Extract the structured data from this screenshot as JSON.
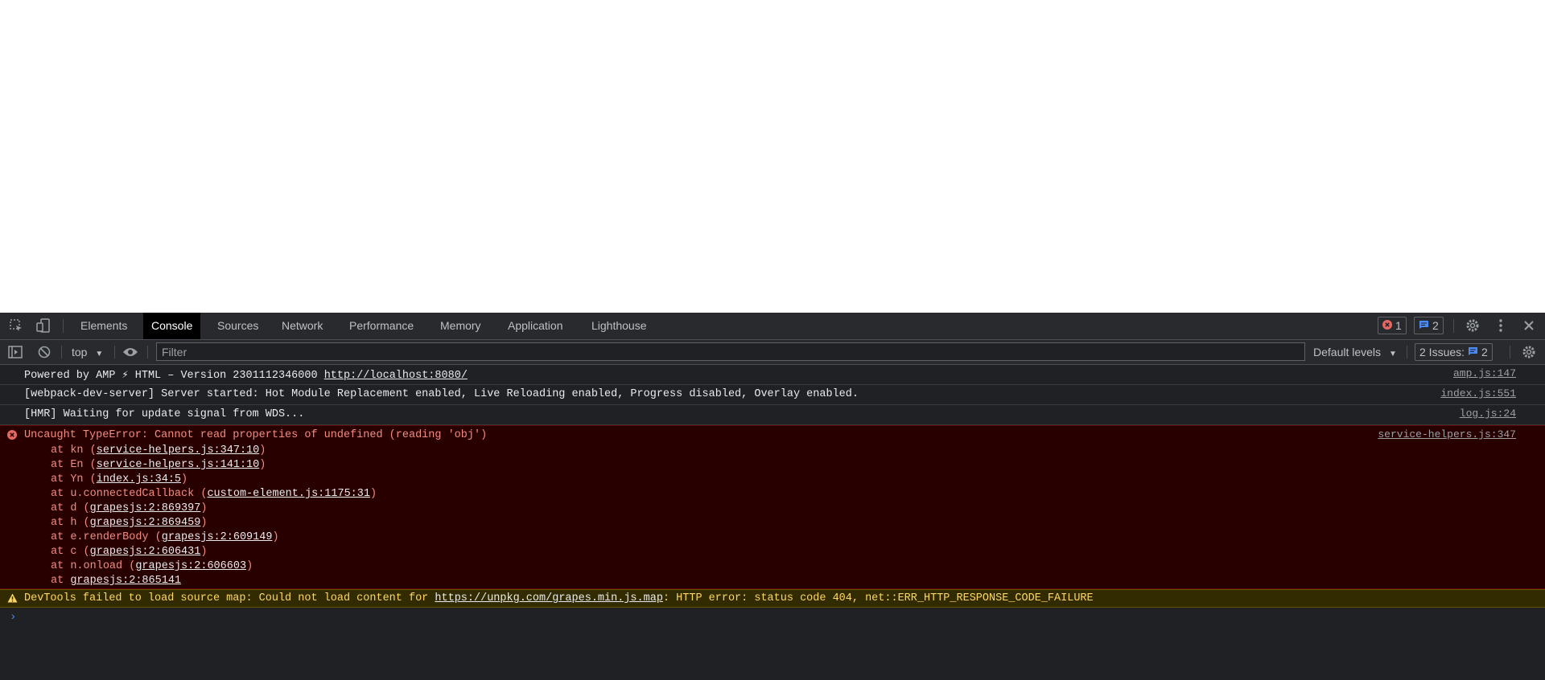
{
  "tabs": [
    {
      "label": "Elements",
      "active": false
    },
    {
      "label": "Console",
      "active": true
    },
    {
      "label": "Sources",
      "active": false
    },
    {
      "label": "Network",
      "active": false
    },
    {
      "label": "Performance",
      "active": false
    },
    {
      "label": "Memory",
      "active": false
    },
    {
      "label": "Application",
      "active": false
    },
    {
      "label": "Lighthouse",
      "active": false
    }
  ],
  "badges": {
    "errors": "1",
    "messages": "2"
  },
  "toolbar": {
    "context": "top",
    "filter_placeholder": "Filter",
    "levels": "Default levels",
    "issues_label": "2 Issues:",
    "issues_count": "2"
  },
  "messages": [
    {
      "type": "log",
      "parts": [
        "Powered by AMP ⚡ HTML – Version 2301112346000 ",
        "http://localhost:8080/"
      ],
      "source": "amp.js:147"
    },
    {
      "type": "log",
      "text": "[webpack-dev-server] Server started: Hot Module Replacement enabled, Live Reloading enabled, Progress disabled, Overlay enabled.",
      "source": "index.js:551"
    },
    {
      "type": "log",
      "text": "[HMR] Waiting for update signal from WDS...",
      "source": "log.js:24"
    }
  ],
  "error": {
    "text": "Uncaught TypeError: Cannot read properties of undefined (reading 'obj')",
    "source": "service-helpers.js:347",
    "stack": [
      {
        "fn": "kn",
        "loc": "service-helpers.js:347:10"
      },
      {
        "fn": "En",
        "loc": "service-helpers.js:141:10"
      },
      {
        "fn": "Yn",
        "loc": "index.js:34:5"
      },
      {
        "fn": "u.connectedCallback",
        "loc": "custom-element.js:1175:31"
      },
      {
        "fn": "d",
        "loc": "grapesjs:2:869397"
      },
      {
        "fn": "h",
        "loc": "grapesjs:2:869459"
      },
      {
        "fn": "e.renderBody",
        "loc": "grapesjs:2:609149"
      },
      {
        "fn": "c",
        "loc": "grapesjs:2:606431"
      },
      {
        "fn": "n.onload",
        "loc": "grapesjs:2:606603"
      },
      {
        "fn": "",
        "loc": "grapesjs:2:865141"
      }
    ]
  },
  "warning": {
    "prefix": "DevTools failed to load source map: Could not load content for ",
    "url": "https://unpkg.com/grapes.min.js.map",
    "suffix": ": HTTP error: status code 404, net::ERR_HTTP_RESPONSE_CODE_FAILURE"
  },
  "prompt": "›",
  "colors": {
    "error_bg": "#290000",
    "warning_bg": "#332b00",
    "active_tab": "#000000",
    "accent": "#4a8af4"
  }
}
